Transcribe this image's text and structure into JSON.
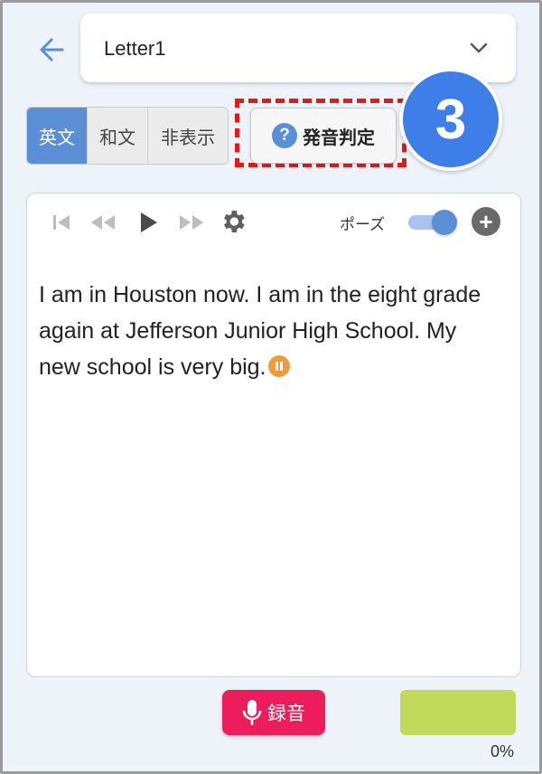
{
  "header": {
    "title": "Letter1"
  },
  "display_mode": {
    "options": [
      "英文",
      "和文",
      "非表示"
    ],
    "selected": "英文"
  },
  "pronunciation_button": {
    "icon_text": "?",
    "label": "発音判定"
  },
  "step_badge": "3",
  "player": {
    "pause_label": "ポーズ",
    "pause_enabled": true
  },
  "passage": {
    "text": "I am in Houston now. I am in the eight grade again at Jefferson Junior High School. My new school is very big."
  },
  "record_button": {
    "label": "録音"
  },
  "score": {
    "value_text": "0%"
  },
  "colors": {
    "accent": "#5a8fd6",
    "record": "#ec1d5a",
    "highlight": "#e21a1a",
    "score_bar": "#c2d95b",
    "badge": "#3e7ee9"
  }
}
